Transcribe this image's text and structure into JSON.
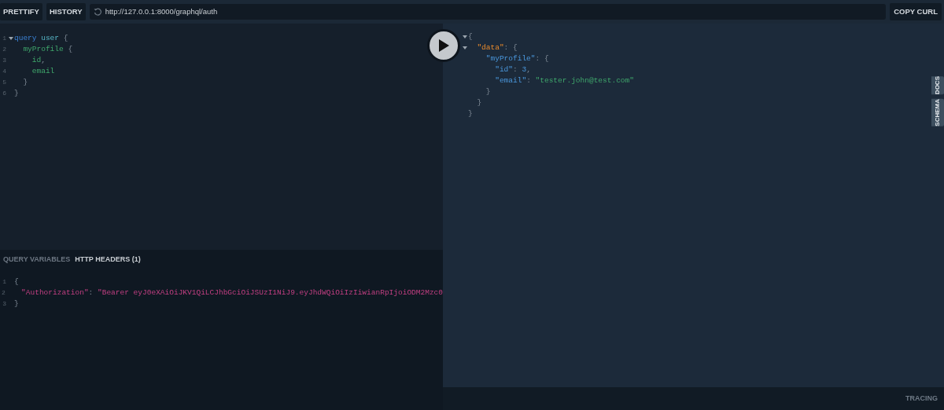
{
  "toolbar": {
    "buttons": [
      "PRETTIFY",
      "HISTORY"
    ],
    "url": "http://127.0.0.1:8000/graphql/auth",
    "copy_button": "COPY CURL"
  },
  "query_editor": {
    "lines": [
      {
        "number": "1",
        "foldable": true,
        "tokens": [
          {
            "text": "query",
            "kind": "keyword"
          },
          {
            "text": " user",
            "kind": "def"
          },
          {
            "text": " {",
            "kind": "punct"
          }
        ]
      },
      {
        "number": "2",
        "foldable": false,
        "tokens": [
          {
            "text": "  myProfile",
            "kind": "field"
          },
          {
            "text": " {",
            "kind": "punct"
          }
        ]
      },
      {
        "number": "3",
        "foldable": false,
        "tokens": [
          {
            "text": "    id",
            "kind": "field"
          },
          {
            "text": ",",
            "kind": "punct"
          }
        ]
      },
      {
        "number": "4",
        "foldable": false,
        "tokens": [
          {
            "text": "    email",
            "kind": "field"
          }
        ]
      },
      {
        "number": "5",
        "foldable": false,
        "tokens": [
          {
            "text": "  }",
            "kind": "punct"
          }
        ]
      },
      {
        "number": "6",
        "foldable": false,
        "tokens": [
          {
            "text": "}",
            "kind": "punct"
          }
        ]
      }
    ]
  },
  "variables_tabs": [
    {
      "label": "QUERY VARIABLES",
      "selected": false
    },
    {
      "label": "HTTP HEADERS (1)",
      "selected": true
    }
  ],
  "headers_editor": {
    "lines": [
      {
        "number": "1",
        "foldable": false,
        "tokens": [
          {
            "text": "{",
            "kind": "punct"
          }
        ]
      },
      {
        "number": "2",
        "foldable": false,
        "tokens": [
          {
            "text": "  \"Authorization\"",
            "kind": "string"
          },
          {
            "text": ": ",
            "kind": "punct"
          },
          {
            "text": "\"Bearer eyJ0eXAiOiJKV1QiLCJhbGciOiJSUzI1NiJ9.eyJhdWQiOiIzIiwianRpIjoiODM2Mzc0",
            "kind": "string"
          }
        ]
      },
      {
        "number": "3",
        "foldable": false,
        "tokens": [
          {
            "text": "}",
            "kind": "punct"
          }
        ]
      }
    ]
  },
  "result": {
    "lines": [
      {
        "foldable": true,
        "tokens": [
          {
            "text": "{",
            "kind": "punct"
          }
        ]
      },
      {
        "foldable": true,
        "tokens": [
          {
            "text": "  \"data\"",
            "kind": "root_key"
          },
          {
            "text": ": {",
            "kind": "punct"
          }
        ]
      },
      {
        "foldable": false,
        "tokens": [
          {
            "text": "    \"myProfile\"",
            "kind": "key"
          },
          {
            "text": ": {",
            "kind": "punct"
          }
        ]
      },
      {
        "foldable": false,
        "tokens": [
          {
            "text": "      \"id\"",
            "kind": "key"
          },
          {
            "text": ": ",
            "kind": "punct"
          },
          {
            "text": "3",
            "kind": "number"
          },
          {
            "text": ",",
            "kind": "punct"
          }
        ]
      },
      {
        "foldable": false,
        "tokens": [
          {
            "text": "      \"email\"",
            "kind": "key"
          },
          {
            "text": ": ",
            "kind": "punct"
          },
          {
            "text": "\"tester.john@test.com\"",
            "kind": "value"
          }
        ]
      },
      {
        "foldable": false,
        "tokens": [
          {
            "text": "    }",
            "kind": "punct"
          }
        ]
      },
      {
        "foldable": false,
        "tokens": [
          {
            "text": "  }",
            "kind": "punct"
          }
        ]
      },
      {
        "foldable": false,
        "tokens": [
          {
            "text": "}",
            "kind": "punct"
          }
        ]
      }
    ]
  },
  "side_tabs": [
    "DOCS",
    "SCHEMA"
  ],
  "footer": {
    "tracing": "TRACING"
  }
}
